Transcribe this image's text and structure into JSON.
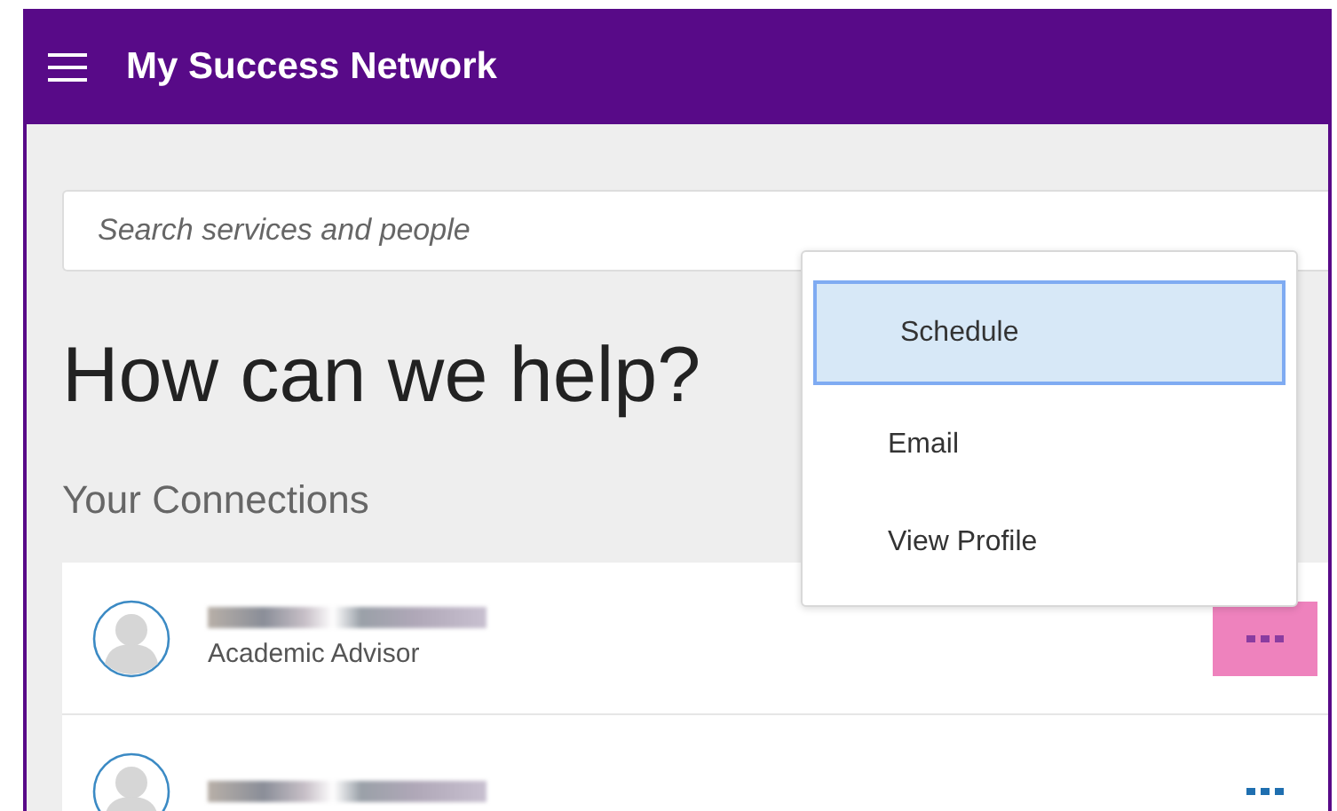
{
  "app_bar": {
    "title": "My Success Network"
  },
  "search": {
    "placeholder": "Search services and people"
  },
  "heading": "How can we help?",
  "connections": {
    "title": "Your Connections",
    "items": [
      {
        "role": "Academic Advisor",
        "menu_open": true
      },
      {
        "menu_open": false
      }
    ]
  },
  "action_menu": {
    "items": [
      {
        "label": "Schedule",
        "selected": true
      },
      {
        "label": "Email",
        "selected": false
      },
      {
        "label": "View Profile",
        "selected": false
      }
    ]
  }
}
